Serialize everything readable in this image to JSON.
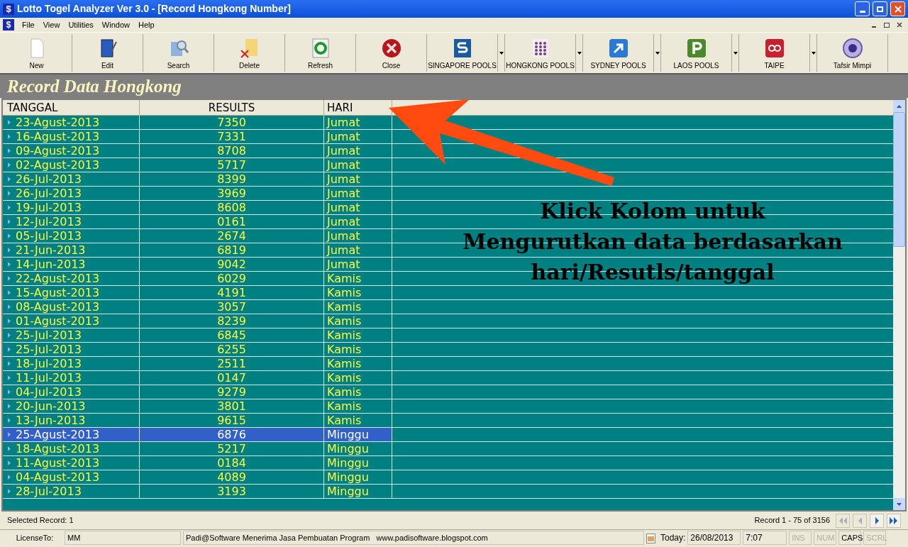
{
  "window": {
    "icon": "$",
    "title": "Lotto Togel Analyzer Ver 3.0 - [Record Hongkong Number]"
  },
  "document_icon": "$",
  "menu": [
    "File",
    "View",
    "Utilities",
    "Window",
    "Help"
  ],
  "toolbar": [
    {
      "label": "New",
      "kind": "new",
      "has_menu": false
    },
    {
      "label": "Edit",
      "kind": "edit",
      "has_menu": false
    },
    {
      "label": "Search",
      "kind": "search",
      "has_menu": false
    },
    {
      "label": "Delete",
      "kind": "delete",
      "has_menu": false
    },
    {
      "label": "Refresh",
      "kind": "refresh",
      "has_menu": false
    },
    {
      "label": "Close",
      "kind": "close",
      "has_menu": false
    },
    {
      "label": "SINGAPORE POOLS",
      "kind": "singapore",
      "has_menu": true
    },
    {
      "label": "HONGKONG POOLS",
      "kind": "hongkong",
      "has_menu": true
    },
    {
      "label": "SYDNEY POOLS",
      "kind": "sydney",
      "has_menu": true
    },
    {
      "label": "LAOS POOLS",
      "kind": "laos",
      "has_menu": true
    },
    {
      "label": "TAIPE",
      "kind": "taipe",
      "has_menu": true
    },
    {
      "label": "Tafsir Mimpi",
      "kind": "mimpi",
      "has_menu": false
    }
  ],
  "panel_title": "Record Data Hongkong",
  "table": {
    "columns": [
      "TANGGAL",
      "RESULTS",
      "HARI"
    ],
    "rows": [
      {
        "cells": [
          "23-Agust-2013",
          "7350",
          "Jumat"
        ],
        "selected": false
      },
      {
        "cells": [
          "16-Agust-2013",
          "7331",
          "Jumat"
        ],
        "selected": false
      },
      {
        "cells": [
          "09-Agust-2013",
          "8708",
          "Jumat"
        ],
        "selected": false
      },
      {
        "cells": [
          "02-Agust-2013",
          "5717",
          "Jumat"
        ],
        "selected": false
      },
      {
        "cells": [
          "26-Jul-2013",
          "8399",
          "Jumat"
        ],
        "selected": false
      },
      {
        "cells": [
          "26-Jul-2013",
          "3969",
          "Jumat"
        ],
        "selected": false
      },
      {
        "cells": [
          "19-Jul-2013",
          "8608",
          "Jumat"
        ],
        "selected": false
      },
      {
        "cells": [
          "12-Jul-2013",
          "0161",
          "Jumat"
        ],
        "selected": false
      },
      {
        "cells": [
          "05-Jul-2013",
          "2674",
          "Jumat"
        ],
        "selected": false
      },
      {
        "cells": [
          "21-Jun-2013",
          "6819",
          "Jumat"
        ],
        "selected": false
      },
      {
        "cells": [
          "14-Jun-2013",
          "9042",
          "Jumat"
        ],
        "selected": false
      },
      {
        "cells": [
          "22-Agust-2013",
          "6029",
          "Kamis"
        ],
        "selected": false
      },
      {
        "cells": [
          "15-Agust-2013",
          "4191",
          "Kamis"
        ],
        "selected": false
      },
      {
        "cells": [
          "08-Agust-2013",
          "3057",
          "Kamis"
        ],
        "selected": false
      },
      {
        "cells": [
          "01-Agust-2013",
          "8239",
          "Kamis"
        ],
        "selected": false
      },
      {
        "cells": [
          "25-Jul-2013",
          "6845",
          "Kamis"
        ],
        "selected": false
      },
      {
        "cells": [
          "25-Jul-2013",
          "6255",
          "Kamis"
        ],
        "selected": false
      },
      {
        "cells": [
          "18-Jul-2013",
          "2511",
          "Kamis"
        ],
        "selected": false
      },
      {
        "cells": [
          "11-Jul-2013",
          "0147",
          "Kamis"
        ],
        "selected": false
      },
      {
        "cells": [
          "04-Jul-2013",
          "9279",
          "Kamis"
        ],
        "selected": false
      },
      {
        "cells": [
          "20-Jun-2013",
          "3801",
          "Kamis"
        ],
        "selected": false
      },
      {
        "cells": [
          "13-Jun-2013",
          "9615",
          "Kamis"
        ],
        "selected": false
      },
      {
        "cells": [
          "25-Agust-2013",
          "6876",
          "Minggu"
        ],
        "selected": true
      },
      {
        "cells": [
          "18-Agust-2013",
          "5217",
          "Minggu"
        ],
        "selected": false
      },
      {
        "cells": [
          "11-Agust-2013",
          "0184",
          "Minggu"
        ],
        "selected": false
      },
      {
        "cells": [
          "04-Agust-2013",
          "4089",
          "Minggu"
        ],
        "selected": false
      },
      {
        "cells": [
          "28-Jul-2013",
          "3193",
          "Minggu"
        ],
        "selected": false
      }
    ]
  },
  "annotation": [
    "Klick Kolom untuk",
    "Mengurutkan data berdasarkan",
    "hari/Resutls/tanggal"
  ],
  "footer": {
    "selected_record": "Selected Record: 1",
    "record_range": "Record 1 - 75 of 3156",
    "nav": [
      {
        "kind": "first",
        "disabled": true
      },
      {
        "kind": "prev",
        "disabled": true
      },
      {
        "kind": "next",
        "disabled": false
      },
      {
        "kind": "last",
        "disabled": false
      }
    ]
  },
  "status_bar": {
    "license_label": "LicenseTo:",
    "license_value": "MM",
    "message": "Padi@Software Menerima Jasa Pembuatan Program   www.padisoftware.blogspot.com",
    "today_label": "Today:",
    "date": "26/08/2013",
    "time": "7:07",
    "keys": [
      {
        "label": "INS",
        "on": false
      },
      {
        "label": "NUM",
        "on": false
      },
      {
        "label": "CAPS",
        "on": true
      },
      {
        "label": "SCRL",
        "on": false
      }
    ]
  }
}
